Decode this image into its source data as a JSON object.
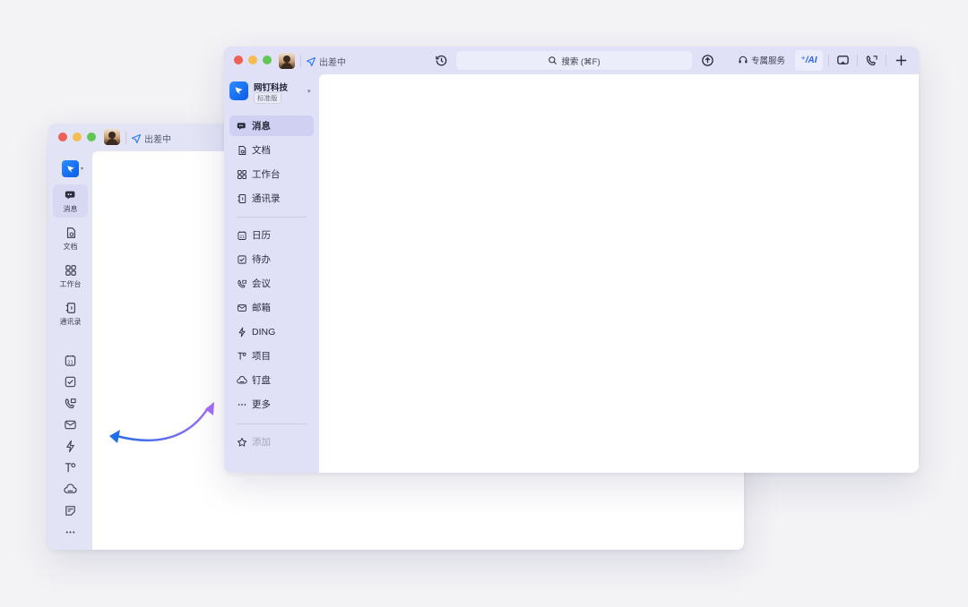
{
  "colors": {
    "background": "#f3f3f6",
    "sidebar": "#e0e0f7",
    "brand": "#1a6dff",
    "arrow_start": "#a66cf5",
    "arrow_end": "#1f6fe8"
  },
  "back_window": {
    "status": "出差中",
    "rail": [
      {
        "label": "消息",
        "icon": "message-icon"
      },
      {
        "label": "文档",
        "icon": "document-icon"
      },
      {
        "label": "工作台",
        "icon": "workbench-icon"
      },
      {
        "label": "通讯录",
        "icon": "contacts-icon"
      }
    ],
    "rail_icons": [
      "calendar-icon",
      "todo-icon",
      "meeting-icon",
      "mail-icon",
      "ding-icon",
      "project-icon",
      "drive-icon",
      "notes-icon",
      "more-icon"
    ]
  },
  "front_window": {
    "status": "出差中",
    "search_label": "搜索 (⌘F)",
    "service_label": "专属服务",
    "ai_label": "⁺/AI",
    "org": {
      "name": "网钉科技",
      "tag": "标准版"
    },
    "nav_primary": [
      {
        "label": "消息",
        "icon": "message-icon"
      },
      {
        "label": "文档",
        "icon": "document-icon"
      },
      {
        "label": "工作台",
        "icon": "workbench-icon"
      },
      {
        "label": "通讯录",
        "icon": "contacts-icon"
      }
    ],
    "nav_secondary": [
      {
        "label": "日历",
        "icon": "calendar-icon"
      },
      {
        "label": "待办",
        "icon": "todo-icon"
      },
      {
        "label": "会议",
        "icon": "meeting-icon"
      },
      {
        "label": "邮箱",
        "icon": "mail-icon"
      },
      {
        "label": "DING",
        "icon": "ding-icon"
      },
      {
        "label": "项目",
        "icon": "project-icon"
      },
      {
        "label": "钉盘",
        "icon": "drive-icon"
      },
      {
        "label": "更多",
        "icon": "more-icon"
      }
    ],
    "add_label": "添加"
  }
}
